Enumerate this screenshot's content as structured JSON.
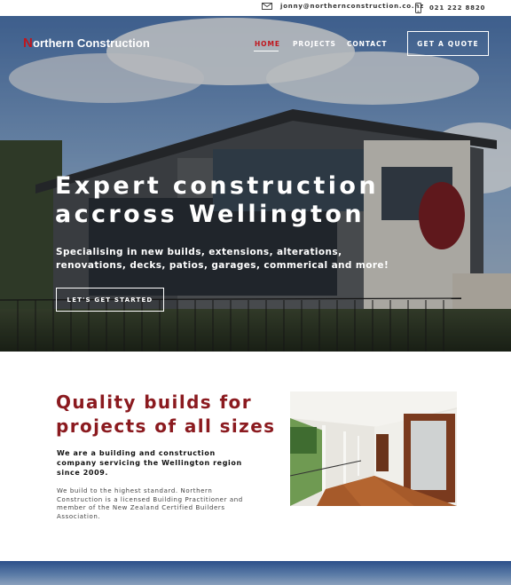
{
  "topbar": {
    "email": "jonny@northernconstruction.co.nz",
    "phone": "021 222 8820"
  },
  "header": {
    "logo_first_letter": "N",
    "logo_rest": "orthern Construction",
    "nav": {
      "home": "HOME",
      "projects": "PROJECTS",
      "contact": "CONTACT"
    },
    "quote_button": "GET A QUOTE",
    "active_nav": "HOME"
  },
  "hero": {
    "title": "Expert construction accross Wellington",
    "subtitle": "Specialising in new builds, extensions, alterations, renovations, decks, patios, garages, commerical and more!",
    "cta": "LET'S GET STARTED"
  },
  "quality": {
    "heading": "Quality builds for projects of all sizes",
    "lead": "We are a building and construction company servicing the Wellington region since 2009.",
    "body": "We build to the highest standard. Northern Construction is a licensed Building Practitioner and member of the New Zealand Certified Builders Association."
  },
  "colors": {
    "brand_red": "#c0161d",
    "heading_maroon": "#8b1a1f"
  }
}
